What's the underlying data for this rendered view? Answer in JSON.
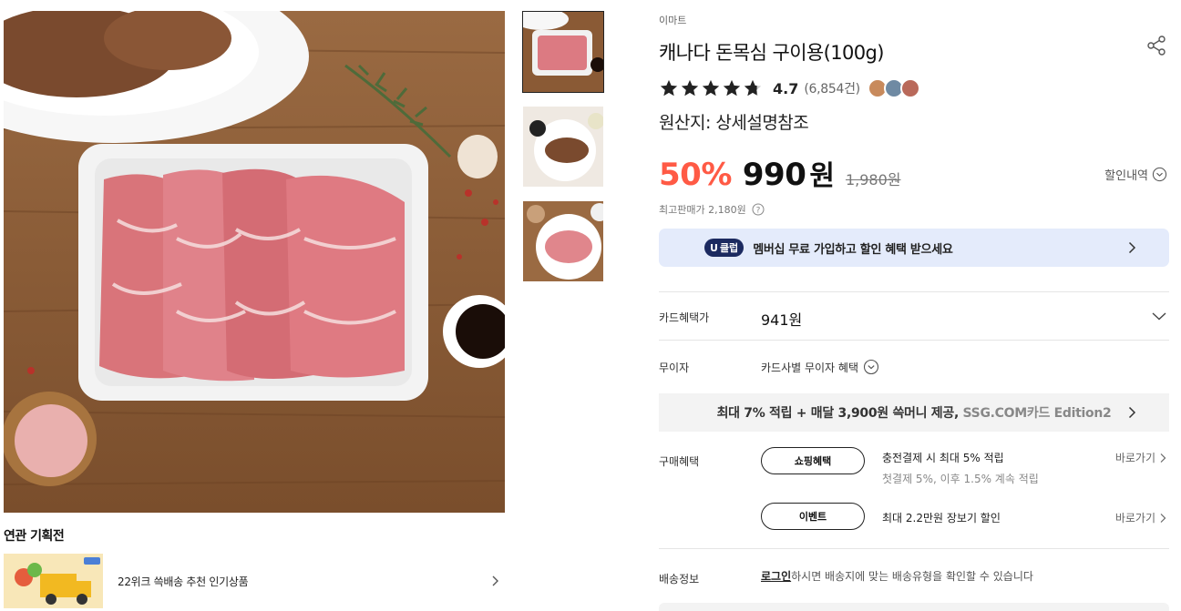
{
  "product": {
    "brand": "이마트",
    "title": "캐나다 돈목심 구이용(100g)",
    "rating": "4.7",
    "review_count": "(6,854건)",
    "stars": 4.7,
    "origin": "원산지: 상세설명참조"
  },
  "price": {
    "discount": "50%",
    "sale": "990",
    "unit": "원",
    "original": "1,980원",
    "discount_detail": "할인내역",
    "max_price": "최고판매가 2,180원"
  },
  "uclub": {
    "badge": "클럽",
    "badge_letter": "U",
    "text": "멤버십 무료 가입하고 할인 혜택 받으세요"
  },
  "card": {
    "label": "카드혜택가",
    "price": "941원"
  },
  "installment": {
    "label": "무이자",
    "text": "카드사별 무이자 혜택"
  },
  "ssg_banner": {
    "text_main": "최대 7% 적립 + 매달 3,900원 쓱머니 제공, ",
    "text_dim": "SSG.COM카드 Edition2"
  },
  "benefits": {
    "label": "구매혜택",
    "items": [
      {
        "pill": "쇼핑혜택",
        "main": "충전결제 시 최대 5% 적립",
        "sub": "첫결제 5%, 이후 1.5% 계속 적립",
        "link": "바로가기"
      },
      {
        "pill": "이벤트",
        "main": "최대 2.2만원 장보기 할인",
        "sub": "",
        "link": "바로가기"
      }
    ]
  },
  "shipping": {
    "label": "배송정보",
    "login": "로그인",
    "text": "하시면 배송지에 맞는 배송유형을 확인할 수 있습니다"
  },
  "related": {
    "title": "연관 기획전",
    "item_label": "22위크 쓱배송 추천 인기상품"
  },
  "colors": {
    "discount_red": "#ff5a45",
    "uclub_bg": "#e4ebfb",
    "uclub_badge": "#1c2a60"
  }
}
